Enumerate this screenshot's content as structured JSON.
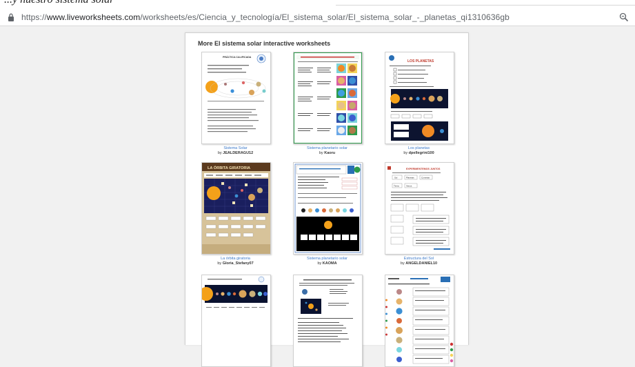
{
  "top_fragment": "...y nuestro sistema solar",
  "browser": {
    "url_scheme": "https://",
    "url_host": "www.liveworksheets.com",
    "url_path": "/worksheets/es/Ciencia_y_tecnología/El_sistema_solar/El_sistema_solar_-_planetas_qi1310636gb",
    "zoom_icon": "magnifier-icon",
    "lock_icon": "lock-icon"
  },
  "panel": {
    "title": "More El sistema solar interactive worksheets"
  },
  "by_prefix": "by",
  "worksheets": [
    {
      "title": "Sistema Solar",
      "author": "JEALDERAGU12"
    },
    {
      "title": "Sistema planetario solar",
      "author": "Kaoru"
    },
    {
      "title": "Los planetas",
      "author": "dpellegrini100"
    },
    {
      "title": "La órbita giratoria",
      "author": "Gloria_Stefany07"
    },
    {
      "title": "Sistema planetario solar",
      "author": "KAOMA"
    },
    {
      "title": "Estructura del Sol",
      "author": "ANGELDANIEL10"
    },
    {
      "title": "",
      "author": ""
    },
    {
      "title": "",
      "author": ""
    },
    {
      "title": "",
      "author": ""
    }
  ],
  "thumb_texts": {
    "w1_header": "PRÁCTICA CALIFICADA",
    "w3_header": "LOS PLANETAS",
    "w4_header": "LA ÓRBITA GIRATORIA",
    "w6_header": "EXPERIMENTEMOS JUNTOS",
    "w6_words": [
      "Sol",
      "Planetas",
      "Cometas",
      "Tierra",
      "Venus",
      "Luna"
    ]
  },
  "colors": {
    "link": "#3a78c9",
    "planet_sun": "#f4a11a",
    "space": "#0d1430",
    "brand_blue": "#2a6fb5",
    "green_panel": "#2e9b4b"
  }
}
